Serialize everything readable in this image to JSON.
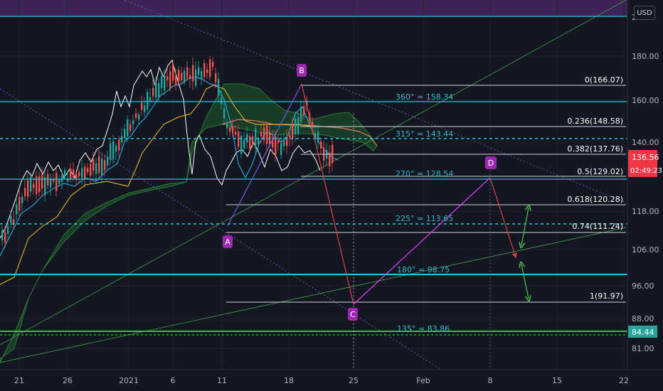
{
  "currency": "USD",
  "chart_data": {
    "type": "line",
    "title": "",
    "price_axis": {
      "ticks": [
        "180.00",
        "160.00",
        "140.00",
        "118.00",
        "106.00",
        "96.00",
        "88.00",
        "81.00"
      ],
      "partial_top_tick": "2"
    },
    "time_axis": {
      "ticks": [
        "21",
        "26",
        "2021",
        "6",
        "11",
        "18",
        "25",
        "Feb",
        "8",
        "15",
        "22"
      ]
    },
    "price_badges": [
      {
        "value": "136.56",
        "sub": "02:49:23",
        "color": "#f23645"
      },
      {
        "value": "84.44",
        "color": "#26a69a"
      }
    ],
    "fib_levels": [
      {
        "ratio": "0",
        "price": 166.07,
        "label": "0(166.07)"
      },
      {
        "ratio": "0.236",
        "price": 148.58,
        "label": "0.236(148.58)"
      },
      {
        "ratio": "0.382",
        "price": 137.76,
        "label": "0.382(137.76)"
      },
      {
        "ratio": "0.5",
        "price": 129.02,
        "label": "0.5(129.02)"
      },
      {
        "ratio": "0.618",
        "price": 120.28,
        "label": "0.618(120.28)"
      },
      {
        "ratio": "0.74",
        "price": 111.24,
        "label": "0.74(111.24)"
      },
      {
        "ratio": "1",
        "price": 91.97,
        "label": "1(91.97)"
      }
    ],
    "gann_levels": [
      {
        "label": "360° = 158.34",
        "price": 158.34
      },
      {
        "label": "315° = 143.44",
        "price": 143.44
      },
      {
        "label": "270° = 128.54",
        "price": 128.54
      },
      {
        "label": "225° = 113.65",
        "price": 113.65
      },
      {
        "label": "180° = 98.75",
        "price": 98.75
      },
      {
        "label": "135° = 83.86",
        "price": 83.86
      }
    ],
    "harmonic_points": [
      {
        "name": "A",
        "date": "Jan 11",
        "price": 112.5
      },
      {
        "name": "B",
        "date": "Jan 20",
        "price": 166.07
      },
      {
        "name": "C",
        "date": "Jan 25",
        "price": 91.97
      },
      {
        "name": "D",
        "date": "Feb 8",
        "price": 129.02
      }
    ]
  }
}
